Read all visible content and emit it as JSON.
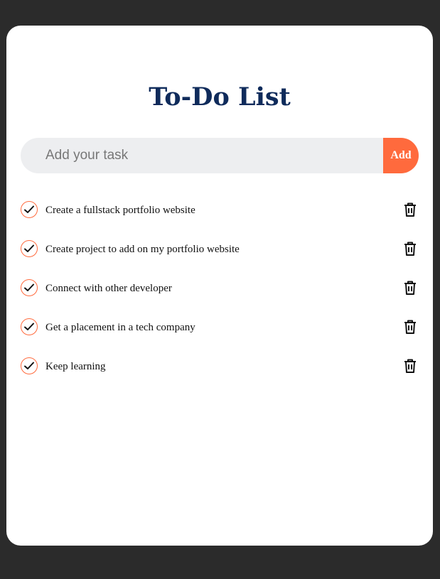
{
  "title": "To-Do List",
  "input": {
    "value": "",
    "placeholder": "Add your task"
  },
  "add_button_label": "Add",
  "tasks": [
    {
      "text": "Create a fullstack portfolio website",
      "checked": true
    },
    {
      "text": "Create project to add on my portfolio website",
      "checked": true
    },
    {
      "text": "Connect with other developer",
      "checked": true
    },
    {
      "text": "Get a placement in a tech company",
      "checked": true
    },
    {
      "text": "Keep learning",
      "checked": true
    }
  ],
  "icons": {
    "check": "check-icon",
    "delete": "trash-icon"
  },
  "colors": {
    "page_background": "#2b2b2b",
    "card_background": "#ffffff",
    "title": "#0f2b5b",
    "accent": "#ff6a3d",
    "input_background": "#edeef0"
  }
}
